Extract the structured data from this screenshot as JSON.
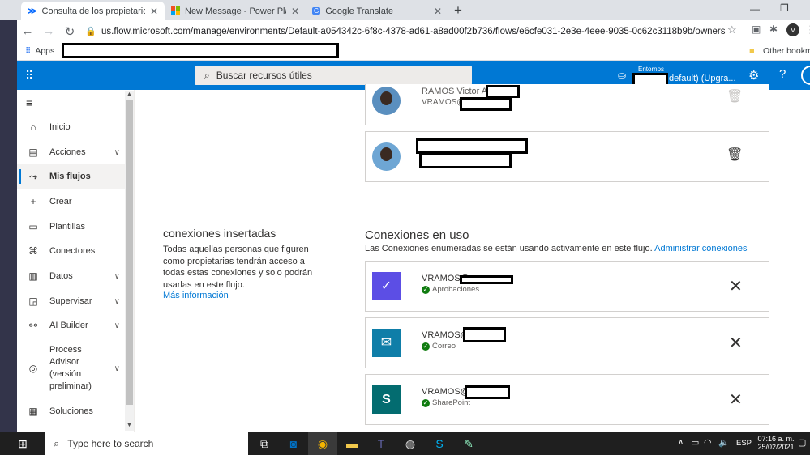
{
  "browser": {
    "tabs": [
      {
        "title": "Consulta de los propietarios del",
        "icon": "power-automate-icon"
      },
      {
        "title": "New Message - Power Platform C",
        "icon": "microsoft-icon"
      },
      {
        "title": "Google Translate",
        "icon": "google-translate-icon"
      }
    ],
    "new_tab": "+",
    "url": "us.flow.microsoft.com/manage/environments/Default-a054342c-6f8c-4378-ad61-a8ad00f2b736/flows/e6cfe031-2e3e-4eee-9035-0c62c3118b9b/owners",
    "bookmarks": {
      "apps_label": "Apps",
      "other_label": "Other bookmarks"
    }
  },
  "app_header": {
    "search_placeholder": "Buscar recursos útiles",
    "env_label": "Entornos",
    "env_name": "default) (Upgra..."
  },
  "sidebar": {
    "items": [
      {
        "label": "Inicio",
        "icon": "home-icon"
      },
      {
        "label": "Acciones",
        "icon": "clipboard-icon",
        "expandable": true
      },
      {
        "label": "Mis flujos",
        "icon": "flow-icon",
        "selected": true
      },
      {
        "label": "Crear",
        "icon": "plus-icon"
      },
      {
        "label": "Plantillas",
        "icon": "template-icon"
      },
      {
        "label": "Conectores",
        "icon": "connector-icon"
      },
      {
        "label": "Datos",
        "icon": "database-icon",
        "expandable": true
      },
      {
        "label": "Supervisar",
        "icon": "chart-icon",
        "expandable": true
      },
      {
        "label": "AI Builder",
        "icon": "ai-icon",
        "expandable": true
      },
      {
        "label": "Process Advisor (versión preliminar)",
        "icon": "process-icon",
        "expandable": true
      },
      {
        "label": "Soluciones",
        "icon": "solutions-icon"
      }
    ]
  },
  "owners": [
    {
      "name": "RAMOS Victor A.",
      "email": "VRAMOS@"
    },
    {
      "name": "",
      "email": ""
    }
  ],
  "embedded": {
    "title": "conexiones insertadas",
    "description": "Todas aquellas personas que figuren como propietarias tendrán acceso a todas estas conexiones y solo podrán usarlas en este flujo.",
    "more_link": "Más información"
  },
  "connections": {
    "title": "Conexiones en uso",
    "subtitle": "Las Conexiones enumeradas se están usando activamente en este flujo.",
    "manage_link": "Administrar conexiones",
    "items": [
      {
        "account": "VRAMOS@",
        "service": "Aprobaciones",
        "color": "#5c4ee5",
        "icon": "approvals-icon"
      },
      {
        "account": "VRAMOS@",
        "service": "Correo",
        "color": "#0f7ea8",
        "icon": "mail-icon"
      },
      {
        "account": "VRAMOS@",
        "service": "SharePoint",
        "color": "#036c70",
        "icon": "sharepoint-icon"
      }
    ]
  },
  "taskbar": {
    "search_placeholder": "Type here to search",
    "language": "ESP",
    "time": "07:16 a. m.",
    "date": "25/02/2021"
  }
}
